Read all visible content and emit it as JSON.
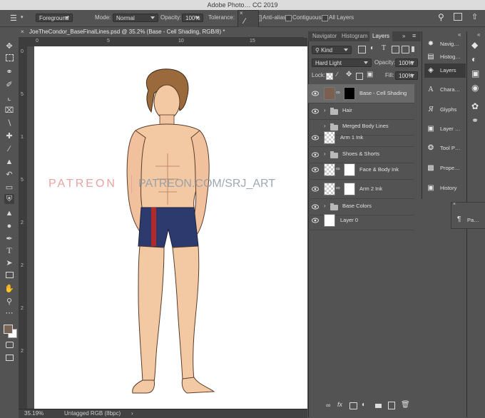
{
  "title_bar": {
    "text": "Adobe Photo…  CC 2019"
  },
  "options_bar": {
    "fill_source": "Foreground",
    "mode_label": "Mode:",
    "mode_value": "Normal",
    "opacity_label": "Opacity:",
    "opacity_value": "100%",
    "tolerance_label": "Tolerance:",
    "antialias_label": "Anti-alias",
    "contiguous_label": "Contiguous",
    "all_layers_label": "All Layers"
  },
  "document": {
    "tab_title": "JoeTheCondor_BaseFinalLines.psd @ 35.2% (Base - Cell Shading, RGB/8) *",
    "ruler_top": [
      "0",
      "5",
      "10",
      "15"
    ],
    "ruler_left": [
      "0",
      "5",
      "1",
      "5",
      "2",
      "2",
      "2",
      "2"
    ],
    "watermark_left": "PATREON",
    "watermark_right": "PATREON.COM/SRJ_ART"
  },
  "status_bar": {
    "zoom": "35.19%",
    "profile": "Untagged RGB (8bpc)",
    "arrow": "›"
  },
  "panel": {
    "tabs": [
      "Navigator",
      "Histogram",
      "Layers"
    ],
    "active_tab": "Layers",
    "filter_value": "Kind",
    "blend_mode": "Hard Light",
    "opacity_label": "Opacity:",
    "opacity_value": "100%",
    "lock_label": "Lock:",
    "fill_label": "Fill:",
    "fill_value": "100%",
    "layers": [
      {
        "name": "Base - Cell Shading",
        "visible": true,
        "selected": true,
        "kind": "masked"
      },
      {
        "name": "Hair",
        "visible": true,
        "selected": false,
        "kind": "group"
      },
      {
        "name": "Merged Body Lines",
        "visible": false,
        "selected": false,
        "kind": "group"
      },
      {
        "name": "Arm 1 Ink",
        "visible": true,
        "selected": false,
        "kind": "layer"
      },
      {
        "name": "Shoes & Shorts",
        "visible": true,
        "selected": false,
        "kind": "group"
      },
      {
        "name": "Face & Body Ink",
        "visible": true,
        "selected": false,
        "kind": "masked"
      },
      {
        "name": "Arm 2 Ink",
        "visible": true,
        "selected": false,
        "kind": "masked"
      },
      {
        "name": "Base Colors",
        "visible": true,
        "selected": false,
        "kind": "group"
      },
      {
        "name": "Layer 0",
        "visible": true,
        "selected": false,
        "kind": "white"
      }
    ]
  },
  "dock": {
    "items": [
      {
        "label": "Navig…",
        "icon": "navigator-icon"
      },
      {
        "label": "Histog…",
        "icon": "histogram-icon"
      },
      {
        "label": "Layers",
        "icon": "layers-icon"
      },
      {
        "label": "Chara…",
        "icon": "character-icon"
      },
      {
        "label": "Glyphs",
        "icon": "glyphs-icon"
      },
      {
        "label": "Layer …",
        "icon": "layer-comps-icon"
      },
      {
        "label": "Tool P…",
        "icon": "tool-presets-icon"
      },
      {
        "label": "Prope…",
        "icon": "properties-icon"
      },
      {
        "label": "History",
        "icon": "history-icon"
      }
    ],
    "paragraph_label": "Pa…"
  },
  "colors": {
    "foreground": "#7a6454",
    "background": "#ffffff",
    "selected_layer_thumb": "#7b5f50",
    "watermark": "#e9a3a3"
  }
}
